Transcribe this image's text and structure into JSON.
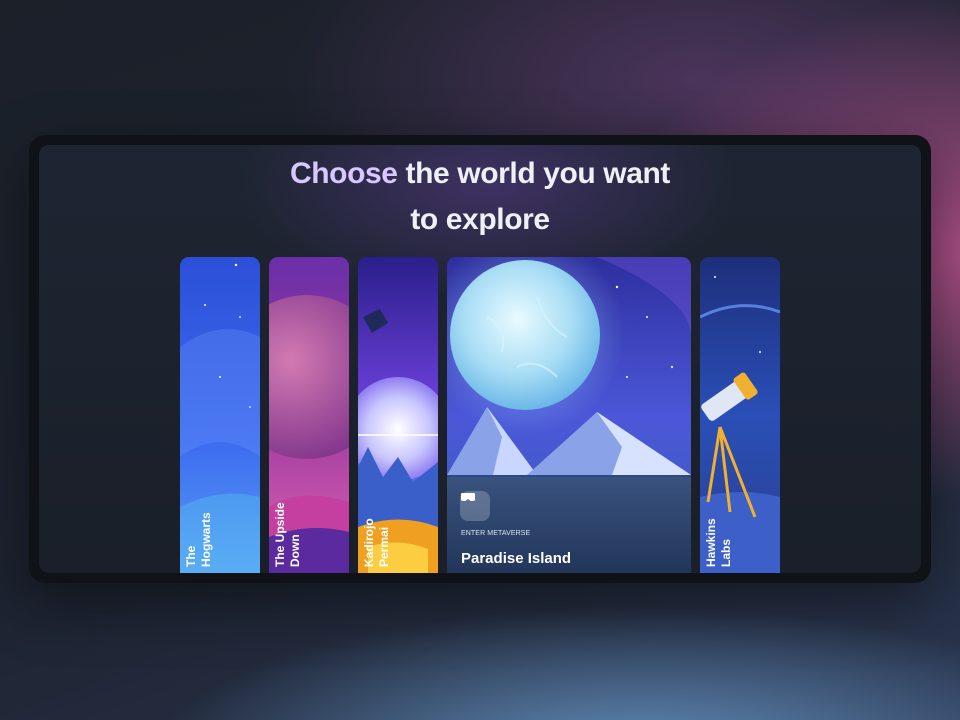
{
  "headline": {
    "accent": "Choose",
    "rest_line1": "the world you want",
    "line2": "to explore"
  },
  "worlds": [
    {
      "line1": "The",
      "line2": "Hogwarts"
    },
    {
      "line1": "The Upside",
      "line2": "Down"
    },
    {
      "line1": "Kadirojo",
      "line2": "Permai"
    },
    {
      "title": "Paradise Island",
      "cta": "ENTER METAVERSE",
      "icon": "vr-headset-icon",
      "active": true
    },
    {
      "line1": "Hawkins",
      "line2": "Labs"
    }
  ],
  "colors": {
    "headline_accent": "#d9c7ff",
    "headline_text": "#eef0f5"
  }
}
